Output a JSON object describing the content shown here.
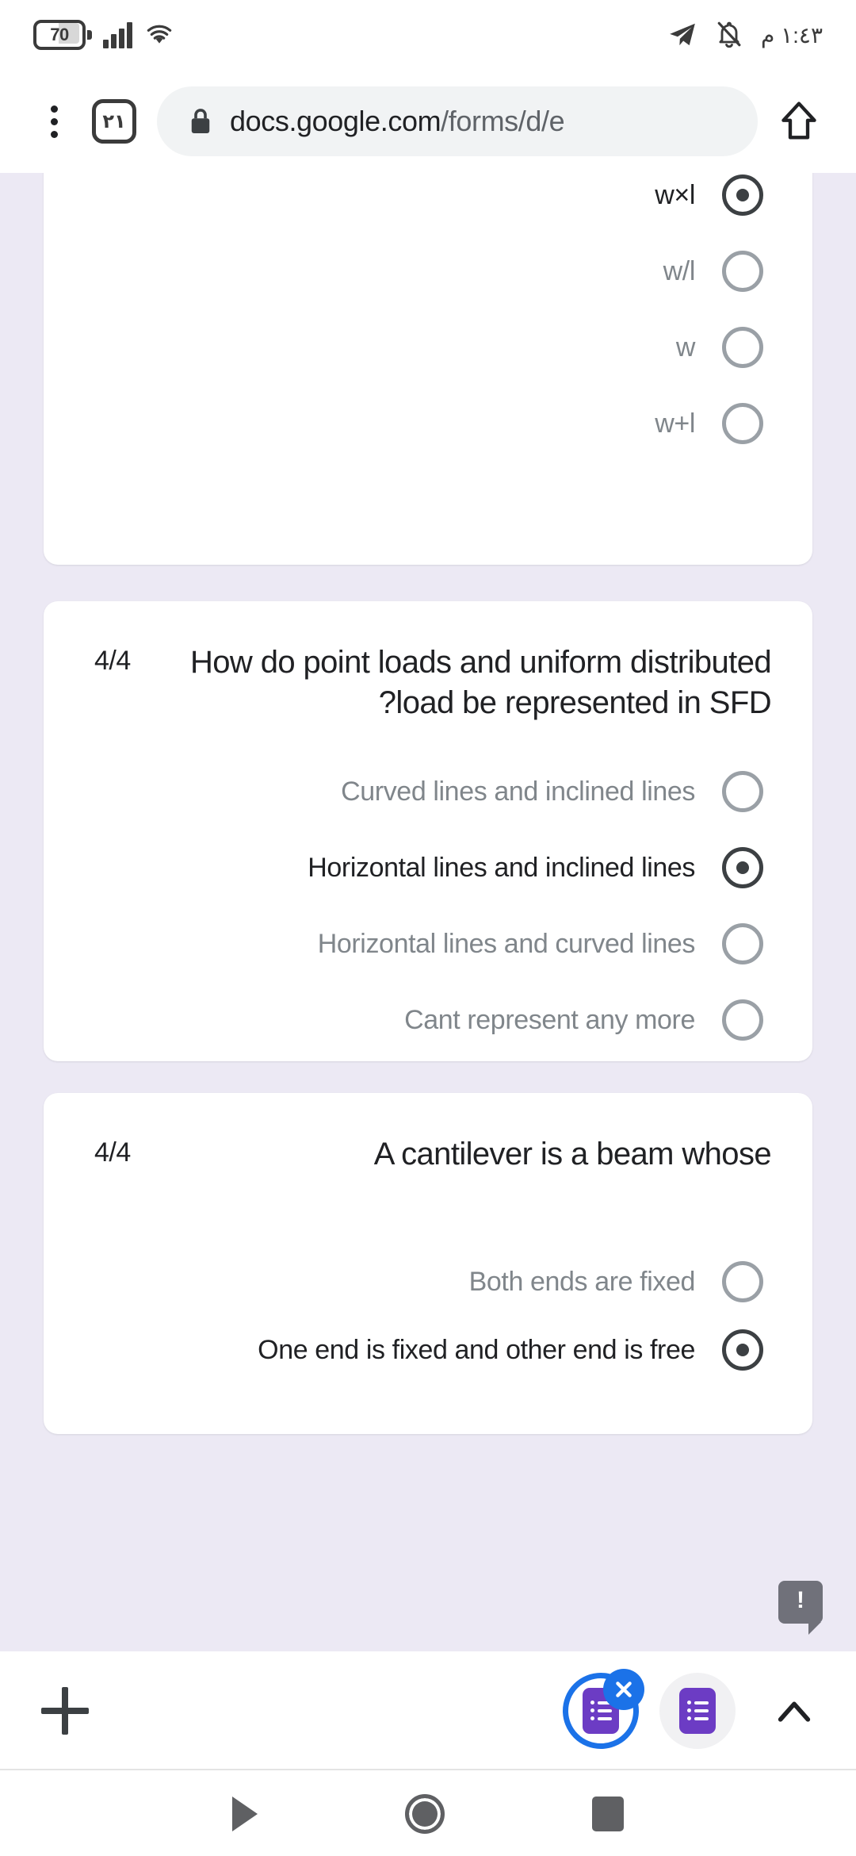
{
  "status_bar": {
    "battery_level": "70",
    "time": "١:٤٣ م",
    "icons": [
      "battery-icon",
      "signal-icon",
      "wifi-icon",
      "telegram-icon",
      "bell-muted-icon"
    ]
  },
  "browser": {
    "menu_label": "⋮",
    "tab_count": "٢١",
    "url_host": "docs.google.com",
    "url_path": "/forms/d/e",
    "url_full": "docs.google.com/forms/d/e",
    "lock_icon": "lock-icon",
    "home_icon": "home-icon"
  },
  "form": {
    "questions": [
      {
        "score": "",
        "title": "",
        "options": [
          {
            "label": "w×l",
            "selected": true
          },
          {
            "label": "w/l",
            "selected": false
          },
          {
            "label": "w",
            "selected": false
          },
          {
            "label": "w+l",
            "selected": false
          }
        ]
      },
      {
        "score": "4/4",
        "title": "How do point loads and uniform distributed load be represented in SFD?",
        "options": [
          {
            "label": "Curved lines and inclined lines",
            "selected": false
          },
          {
            "label": "Horizontal lines and inclined lines",
            "selected": true
          },
          {
            "label": "Horizontal lines and curved lines",
            "selected": false
          },
          {
            "label": "Cant represent any more",
            "selected": false
          }
        ]
      },
      {
        "score": "4/4",
        "title": "A cantilever is a beam whose",
        "options": [
          {
            "label": "Both ends are fixed",
            "selected": false
          },
          {
            "label": "One end is fixed and other end is free",
            "selected": true
          }
        ]
      }
    ],
    "warning_badge": "!"
  },
  "tab_bar": {
    "new_tab_label": "+",
    "tabs": [
      {
        "name": "google-forms-tab",
        "active": true,
        "closable": true
      },
      {
        "name": "google-forms-tab",
        "active": false,
        "closable": false
      }
    ],
    "expand_icon": "chevron-up-icon"
  },
  "nav_bar": {
    "back_icon": "back-triangle-icon",
    "home_icon": "home-circle-icon",
    "recents_icon": "recents-square-icon"
  },
  "colors": {
    "page_background": "#ece9f4",
    "card_background": "#ffffff",
    "accent_blue": "#1b72e8",
    "forms_purple": "#6c3cc4",
    "text_primary": "#202124",
    "text_secondary": "#80868b"
  }
}
